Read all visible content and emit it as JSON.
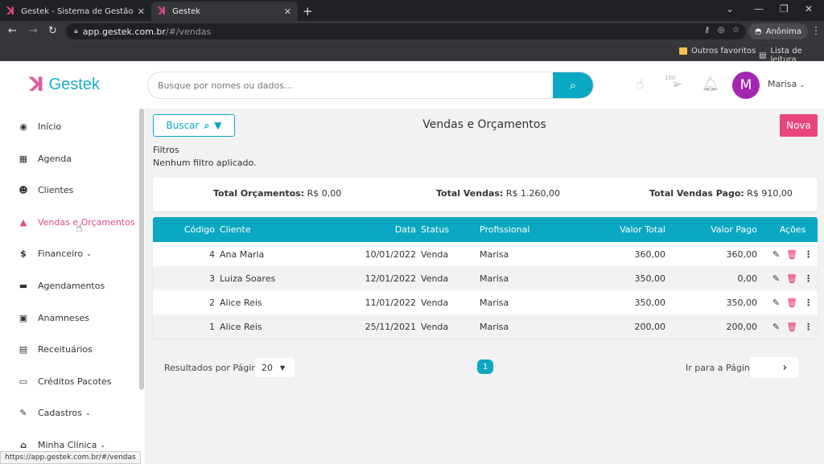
{
  "browser": {
    "tabs": [
      {
        "title": "Gestek - Sistema de Gestão para"
      },
      {
        "title": "Gestek"
      }
    ],
    "url_host": "app.gestek.com.br",
    "url_path": "/#/vendas",
    "incognito_label": "Anônima",
    "bookmarks": {
      "others": "Outros favoritos",
      "reading_list": "Lista de leitura"
    },
    "status_url": "https://app.gestek.com.br/#/vendas"
  },
  "header": {
    "logo_text": "Gestek",
    "search_placeholder": "Busque por nomes ou dados...",
    "notif_count": "100",
    "avatar_letter": "M",
    "user_name": "Marisa"
  },
  "sidebar": {
    "items": [
      {
        "label": "Início",
        "icon": "dashboard-icon",
        "glyph": "◉"
      },
      {
        "label": "Agenda",
        "icon": "calendar-icon",
        "glyph": "▦"
      },
      {
        "label": "Clientes",
        "icon": "users-icon",
        "glyph": "☻"
      },
      {
        "label": "Vendas e Orçamentos",
        "icon": "shopping-bag-icon",
        "glyph": "▲",
        "active": true
      },
      {
        "label": "Financeiro",
        "icon": "dollar-icon",
        "glyph": "$",
        "chevron": true
      },
      {
        "label": "Agendamentos",
        "icon": "calendar-check-icon",
        "glyph": "▬"
      },
      {
        "label": "Anamneses",
        "icon": "id-card-icon",
        "glyph": "▣"
      },
      {
        "label": "Receituários",
        "icon": "file-icon",
        "glyph": "▤"
      },
      {
        "label": "Créditos Pacotes",
        "icon": "box-icon",
        "glyph": "▭"
      },
      {
        "label": "Cadastros",
        "icon": "edit-icon",
        "glyph": "✎",
        "chevron": true
      },
      {
        "label": "Minha Clínica",
        "icon": "home-icon",
        "glyph": "⌂",
        "chevron": true
      }
    ]
  },
  "main": {
    "buscar_label": "Buscar",
    "page_title": "Vendas e Orçamentos",
    "nova_label": "Nova",
    "filters_title": "Filtros",
    "filters_value": "Nenhum filtro aplicado.",
    "totals": {
      "orcamentos_label": "Total Orçamentos:",
      "orcamentos_value": "R$ 0,00",
      "vendas_label": "Total Vendas:",
      "vendas_value": "R$ 1.260,00",
      "vendas_pago_label": "Total Vendas Pago:",
      "vendas_pago_value": "R$ 910,00"
    },
    "table": {
      "headers": {
        "codigo": "Código",
        "cliente": "Cliente",
        "data": "Data",
        "status": "Status",
        "profissional": "Profissional",
        "valor_total": "Valor Total",
        "valor_pago": "Valor Pago",
        "acoes": "Ações"
      },
      "rows": [
        {
          "codigo": "4",
          "cliente": "Ana Maria",
          "data": "10/01/2022",
          "status": "Venda",
          "profissional": "Marisa",
          "valor_total": "360,00",
          "valor_pago": "360,00"
        },
        {
          "codigo": "3",
          "cliente": "Luiza Soares",
          "data": "12/01/2022",
          "status": "Venda",
          "profissional": "Marisa",
          "valor_total": "350,00",
          "valor_pago": "0,00"
        },
        {
          "codigo": "2",
          "cliente": "Alice Reis",
          "data": "11/01/2022",
          "status": "Venda",
          "profissional": "Marisa",
          "valor_total": "350,00",
          "valor_pago": "350,00"
        },
        {
          "codigo": "1",
          "cliente": "Alice Reis",
          "data": "25/11/2021",
          "status": "Venda",
          "profissional": "Marisa",
          "valor_total": "200,00",
          "valor_pago": "200,00"
        }
      ]
    },
    "pagination": {
      "per_page_label": "Resultados por Página",
      "per_page_value": "20",
      "current_page": "1",
      "goto_label": "Ir para a Página"
    }
  },
  "colors": {
    "primary": "#0aa8c2",
    "accent": "#e8457f",
    "avatar": "#a425b2"
  }
}
